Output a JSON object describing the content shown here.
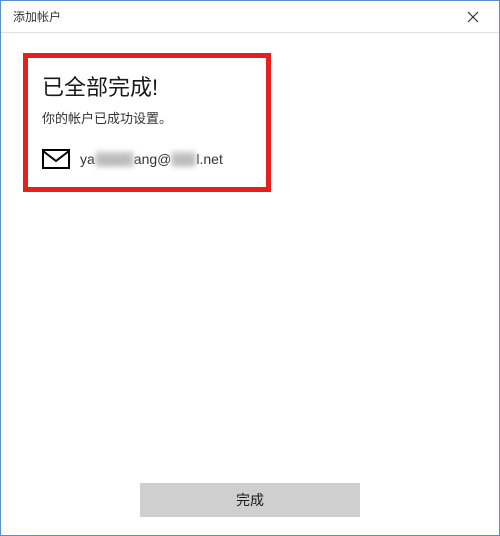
{
  "titlebar": {
    "title": "添加帐户"
  },
  "content": {
    "heading": "已全部完成!",
    "subtext": "你的帐户已成功设置。",
    "email": {
      "prefix": "ya",
      "redacted1": "xxxxx",
      "mid": "ang@",
      "redacted2": "xxx",
      "suffix": "l.net"
    }
  },
  "footer": {
    "done_label": "完成"
  }
}
